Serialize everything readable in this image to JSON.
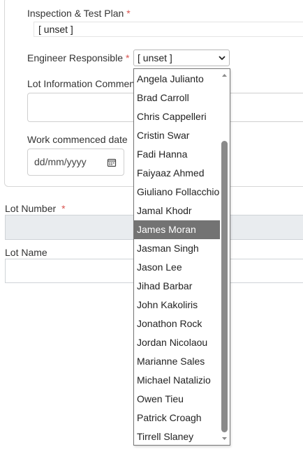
{
  "form": {
    "itp_label": "Inspection & Test Plan",
    "itp_value": "[ unset ]",
    "engineer_label": "Engineer Responsible",
    "engineer_value": "[ unset ]",
    "lot_comments_label": "Lot Information Comments",
    "work_date_label": "Work commenced date",
    "work_date_placeholder": "dd/mm/yyyy",
    "lot_number_label": "Lot Number",
    "lot_name_label": "Lot Name",
    "required_marker": "*"
  },
  "dropdown": {
    "options": [
      "Angela Julianto",
      "Brad Carroll",
      "Chris Cappelleri",
      "Cristin Swar",
      "Fadi Hanna",
      "Faiyaaz Ahmed",
      "Giuliano Follacchio",
      "Jamal Khodr",
      "James Moran",
      "Jasman Singh",
      "Jason Lee",
      "Jihad Barbar",
      "John Kakoliris",
      "Jonathon Rock",
      "Jordan Nicolaou",
      "Marianne Sales",
      "Michael Natalizio",
      "Owen Tieu",
      "Patrick Croagh",
      "Tirrell Slaney"
    ],
    "highlighted_option": "James Moran"
  },
  "colors": {
    "required": "#d9534f",
    "highlight": "#737373",
    "readonly_bg": "#e9ecef"
  }
}
